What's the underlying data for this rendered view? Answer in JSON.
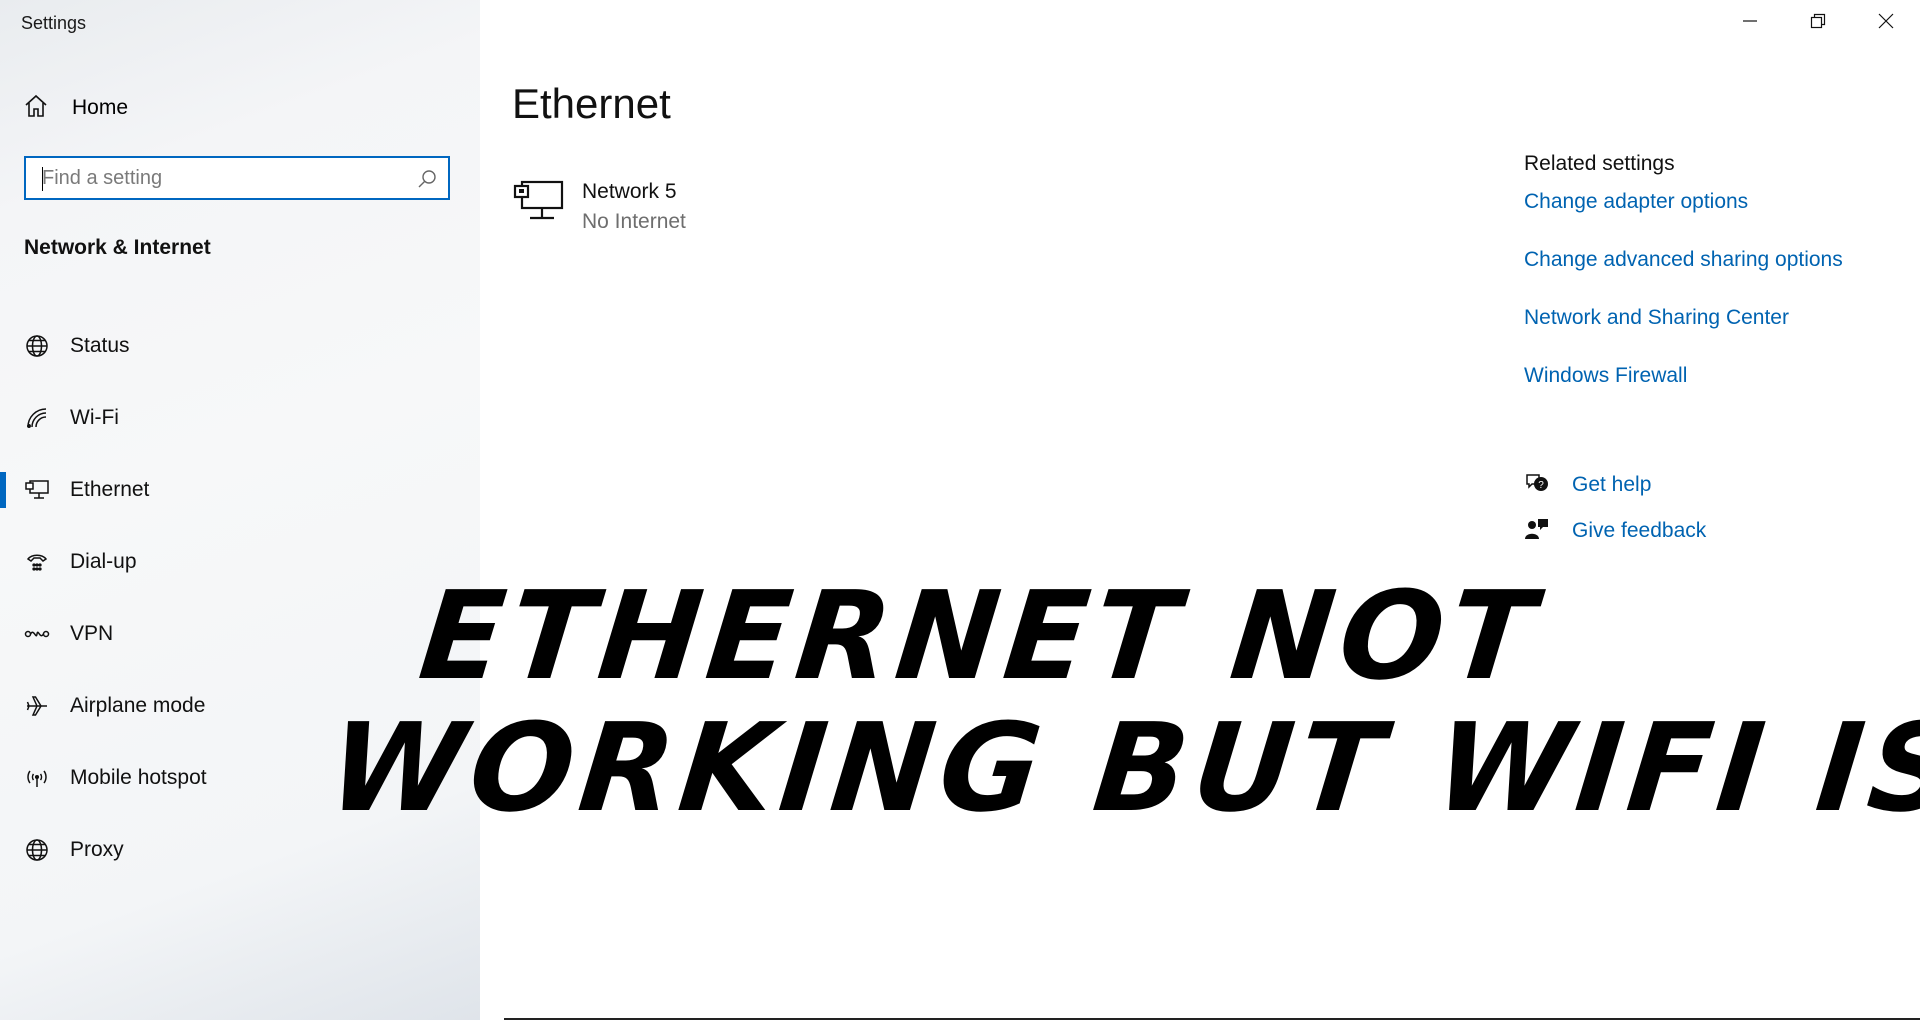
{
  "window": {
    "title": "Settings",
    "controls": {
      "minimize": "minimize-icon",
      "restore": "restore-icon",
      "close": "close-icon"
    }
  },
  "sidebar": {
    "home_label": "Home",
    "search": {
      "placeholder": "Find a setting",
      "value": ""
    },
    "section_title": "Network & Internet",
    "items": [
      {
        "label": "Status",
        "icon": "globe-status-icon"
      },
      {
        "label": "Wi-Fi",
        "icon": "wifi-icon"
      },
      {
        "label": "Ethernet",
        "icon": "ethernet-icon",
        "active": true
      },
      {
        "label": "Dial-up",
        "icon": "dialup-icon"
      },
      {
        "label": "VPN",
        "icon": "vpn-icon"
      },
      {
        "label": "Airplane mode",
        "icon": "airplane-icon"
      },
      {
        "label": "Mobile hotspot",
        "icon": "hotspot-icon"
      },
      {
        "label": "Proxy",
        "icon": "globe-icon"
      }
    ]
  },
  "main": {
    "title": "Ethernet",
    "network": {
      "name": "Network 5",
      "status": "No Internet",
      "icon": "ethernet-network-icon"
    },
    "related": {
      "heading": "Related settings",
      "links": [
        "Change adapter options",
        "Change advanced sharing options",
        "Network and Sharing Center",
        "Windows Firewall"
      ]
    },
    "help": [
      {
        "label": "Get help",
        "icon": "help-chat-icon"
      },
      {
        "label": "Give feedback",
        "icon": "feedback-icon"
      }
    ]
  },
  "overlay": {
    "line1": "ETHERNET NOT",
    "line2": "WORKING BUT WIFI IS"
  },
  "colors": {
    "accent": "#0067c0",
    "link": "#0063b1"
  }
}
